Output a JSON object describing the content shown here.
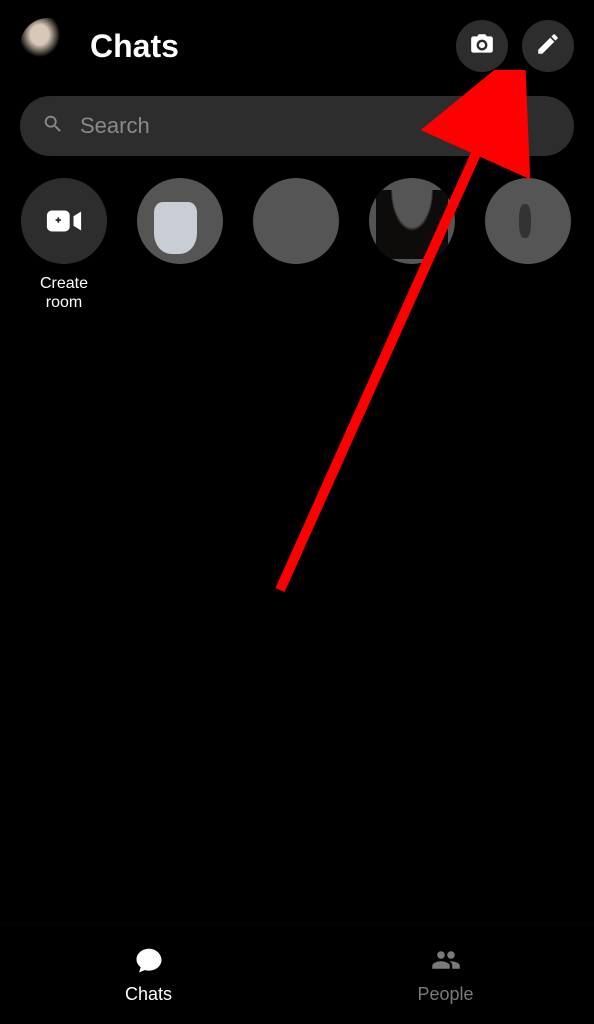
{
  "header": {
    "title": "Chats"
  },
  "search": {
    "placeholder": "Search"
  },
  "stories": {
    "create_label": "Create room"
  },
  "tabs": {
    "chats": "Chats",
    "people": "People"
  }
}
